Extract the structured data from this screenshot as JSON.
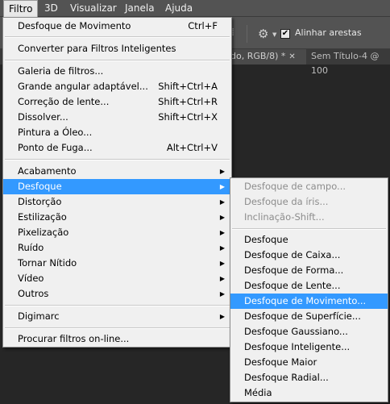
{
  "menubar": {
    "items": [
      {
        "label": "Filtro"
      },
      {
        "label": "3D"
      },
      {
        "label": "Visualizar"
      },
      {
        "label": "Janela"
      },
      {
        "label": "Ajuda"
      }
    ]
  },
  "options": {
    "gear_icon": "gear-icon",
    "checkbox_label": "Alinhar arestas",
    "checkbox_checked": true
  },
  "tabs": [
    {
      "label": "do, RGB/8) *"
    },
    {
      "label": "Sem Título-4 @ 100"
    }
  ],
  "filter_menu": {
    "last_filter": {
      "label": "Desfoque de Movimento",
      "shortcut": "Ctrl+F"
    },
    "smart": {
      "label": "Converter para Filtros Inteligentes"
    },
    "group1": [
      {
        "label": "Galeria de filtros...",
        "shortcut": ""
      },
      {
        "label": "Grande angular adaptável...",
        "shortcut": "Shift+Ctrl+A"
      },
      {
        "label": "Correção de lente...",
        "shortcut": "Shift+Ctrl+R"
      },
      {
        "label": "Dissolver...",
        "shortcut": "Shift+Ctrl+X"
      },
      {
        "label": "Pintura a Óleo...",
        "shortcut": ""
      },
      {
        "label": "Ponto de Fuga...",
        "shortcut": "Alt+Ctrl+V"
      }
    ],
    "group2": [
      {
        "label": "Acabamento"
      },
      {
        "label": "Desfoque"
      },
      {
        "label": "Distorção"
      },
      {
        "label": "Estilização"
      },
      {
        "label": "Pixelização"
      },
      {
        "label": "Ruído"
      },
      {
        "label": "Tornar Nítido"
      },
      {
        "label": "Vídeo"
      },
      {
        "label": "Outros"
      }
    ],
    "digimarc": {
      "label": "Digimarc"
    },
    "online": {
      "label": "Procurar filtros on-line..."
    }
  },
  "blur_submenu": {
    "gallery": [
      {
        "label": "Desfoque de campo..."
      },
      {
        "label": "Desfoque da íris..."
      },
      {
        "label": "Inclinação-Shift..."
      }
    ],
    "items": [
      {
        "label": "Desfoque"
      },
      {
        "label": "Desfoque de Caixa..."
      },
      {
        "label": "Desfoque de Forma..."
      },
      {
        "label": "Desfoque de Lente..."
      },
      {
        "label": "Desfoque de Movimento..."
      },
      {
        "label": "Desfoque de Superfície..."
      },
      {
        "label": "Desfoque Gaussiano..."
      },
      {
        "label": "Desfoque Inteligente..."
      },
      {
        "label": "Desfoque Maior"
      },
      {
        "label": "Desfoque Radial..."
      },
      {
        "label": "Média"
      }
    ]
  },
  "colors": {
    "highlight": "#3399ff",
    "menu_bg": "#f0f0f0",
    "chrome": "#535353"
  }
}
